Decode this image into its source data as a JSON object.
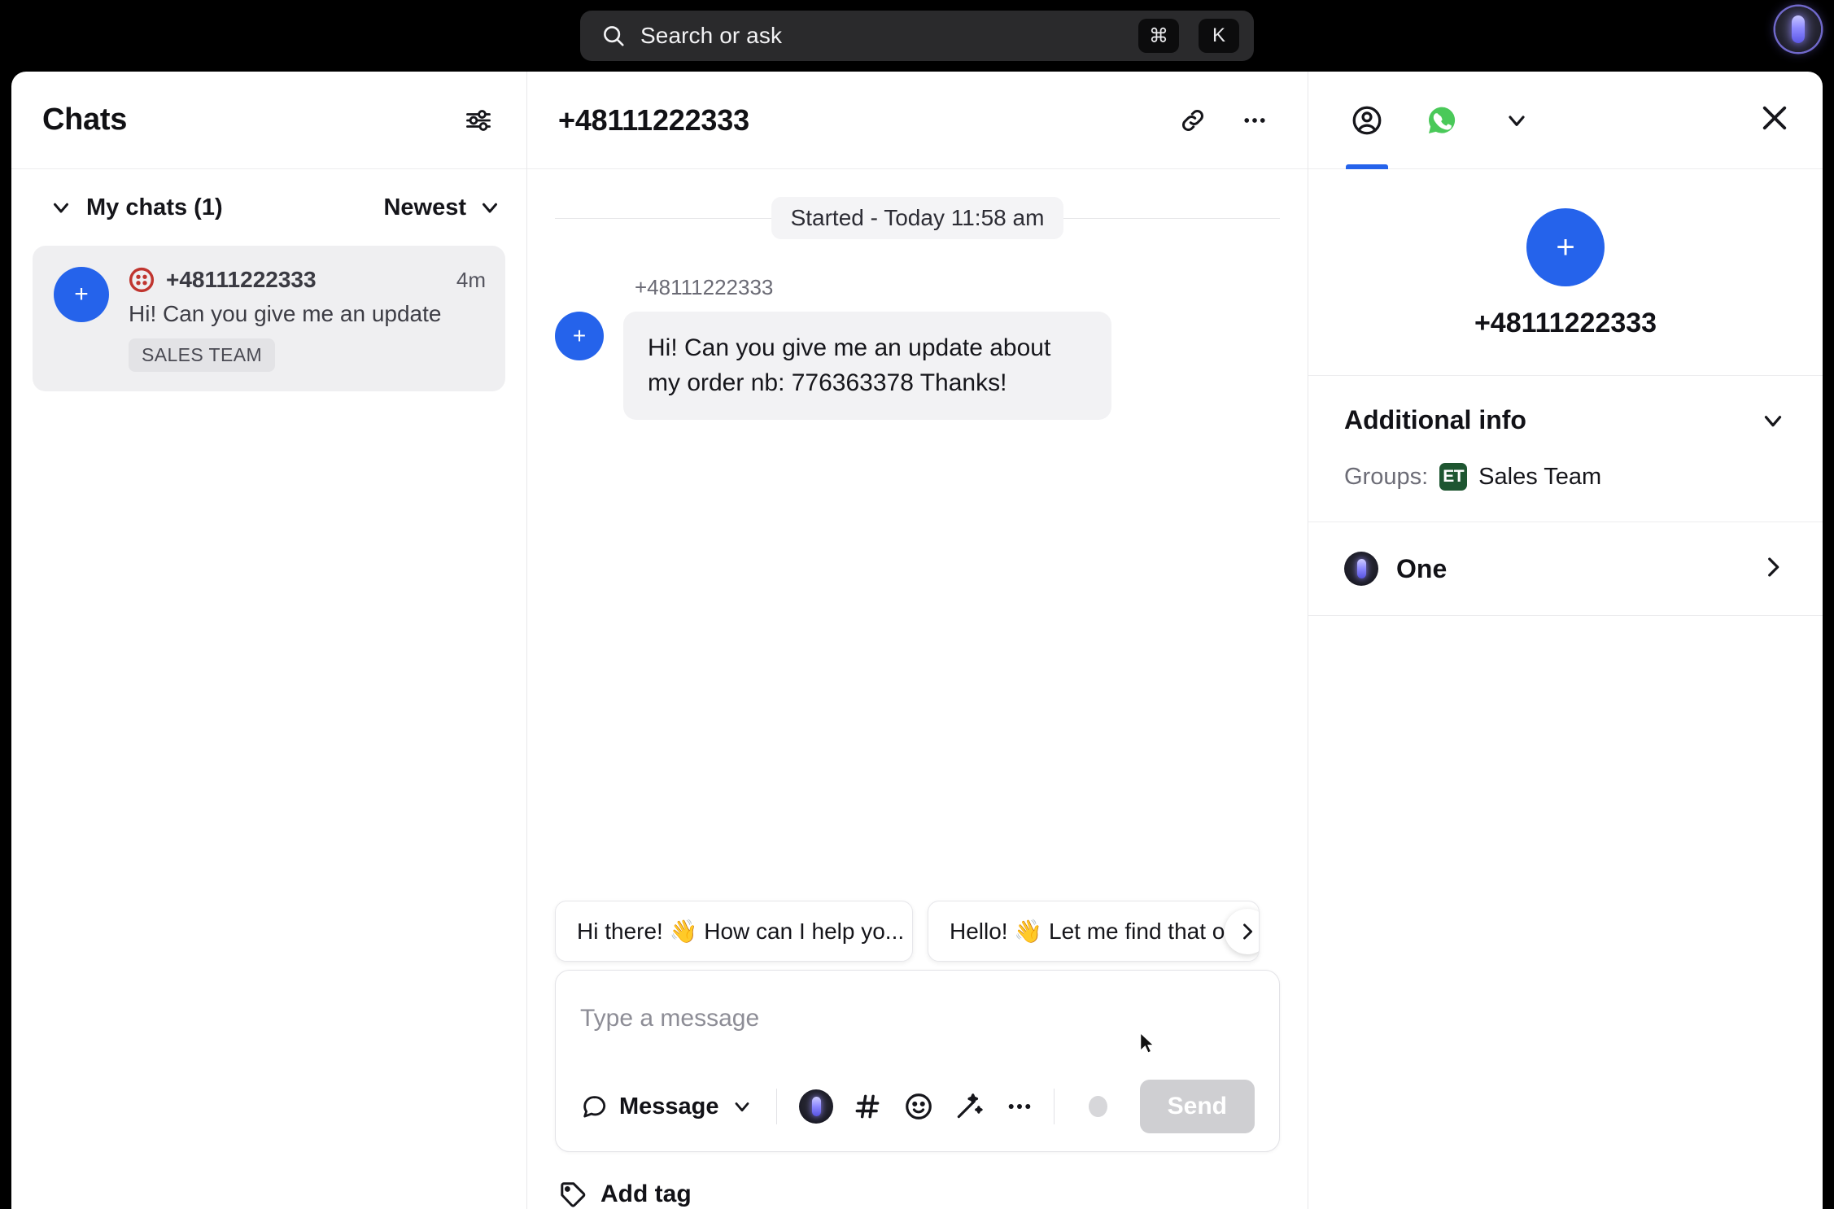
{
  "topbar": {
    "search_placeholder": "Search or ask",
    "shortcut_keys": [
      "⌘",
      "K"
    ],
    "search_icon": "search-icon",
    "avatar_icon": "ai-orb-avatar-icon"
  },
  "sidebar": {
    "title": "Chats",
    "filter_icon": "sliders-filter-icon",
    "group_label": "My chats (1)",
    "group_chevron_icon": "chevron-down-icon",
    "sort_label": "Newest",
    "sort_chevron_icon": "chevron-down-icon",
    "chats": [
      {
        "avatar_initial": "+",
        "channel_icon": "channel-dots-icon",
        "name": "+48111222333",
        "time": "4m",
        "snippet": "Hi! Can you give me an update",
        "tag": "SALES TEAM"
      }
    ]
  },
  "conversation": {
    "title": "+48111222333",
    "link_icon": "link-icon",
    "more_icon": "ellipsis-icon",
    "divider": "Started - Today 11:58 am",
    "messages": [
      {
        "sender": "+48111222333",
        "avatar_initial": "+",
        "text": "Hi! Can you give me an update about my order nb: 776363378 Thanks!"
      }
    ],
    "quick_replies": [
      "Hi there! 👋 How can I help yo...",
      "Hello! 👋 Let me find that ou"
    ],
    "quick_next_icon": "chevron-right-icon",
    "composer": {
      "placeholder": "Type a message",
      "message_type_label": "Message",
      "message_type_icon": "chat-bubble-icon",
      "message_type_chevron_icon": "chevron-down-icon",
      "tools": [
        {
          "icon": "ai-orb-icon",
          "label": "AI assistant"
        },
        {
          "icon": "hash-icon",
          "label": "Canned response"
        },
        {
          "icon": "emoji-smile-icon",
          "label": "Emoji"
        },
        {
          "icon": "magic-wand-icon",
          "label": "Enhance"
        },
        {
          "icon": "ellipsis-icon",
          "label": "More"
        }
      ],
      "record_icon": "record-circle-icon",
      "send_label": "Send"
    },
    "add_tag_label": "Add tag",
    "add_tag_icon": "tag-icon"
  },
  "right_panel": {
    "tabs": [
      {
        "icon": "person-circle-icon",
        "active": true
      },
      {
        "icon": "whatsapp-icon",
        "active": false
      },
      {
        "icon": "chevron-down-icon",
        "active": false
      }
    ],
    "close_icon": "close-icon",
    "contact": {
      "avatar_initial": "+",
      "name": "+48111222333"
    },
    "additional_info": {
      "title": "Additional info",
      "chevron_icon": "chevron-down-icon",
      "groups_label": "Groups:",
      "group_badge": "ET",
      "group_name": "Sales Team"
    },
    "assistant_row": {
      "icon": "ai-orb-icon",
      "label": "One",
      "chevron_icon": "chevron-right-icon"
    }
  }
}
